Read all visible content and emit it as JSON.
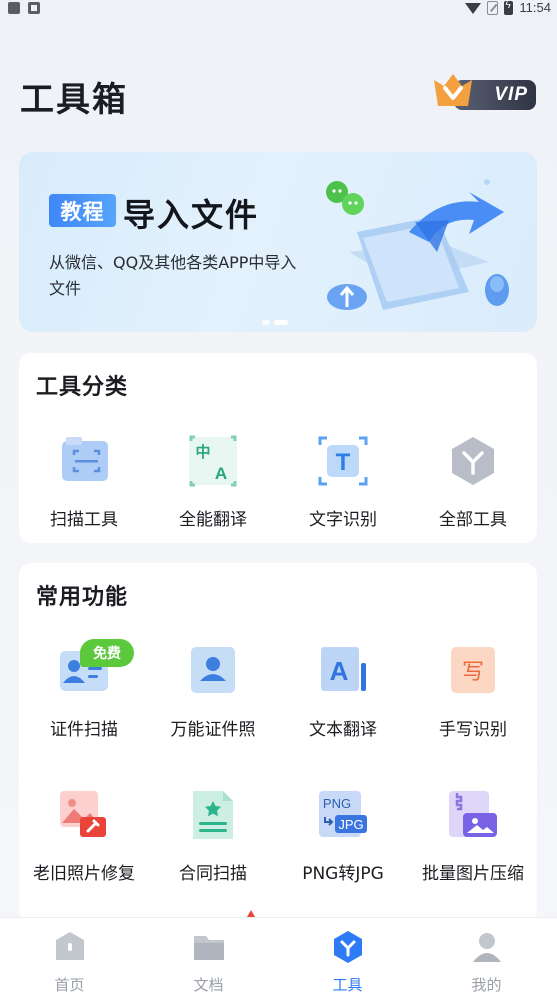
{
  "status_bar": {
    "time": "11:54"
  },
  "header": {
    "title": "工具箱",
    "vip_label": "VIP"
  },
  "banner": {
    "tag": "教程",
    "title": "导入文件",
    "subtitle": "从微信、QQ及其他各类APP中导入文件"
  },
  "tool_categories": {
    "title": "工具分类",
    "items": [
      {
        "label": "扫描工具",
        "icon": "scan-icon"
      },
      {
        "label": "全能翻译",
        "icon": "translate-icon"
      },
      {
        "label": "文字识别",
        "icon": "text-recognition-icon"
      },
      {
        "label": "全部工具",
        "icon": "all-tools-icon"
      }
    ]
  },
  "common_functions": {
    "title": "常用功能",
    "free_badge": "免费",
    "items": [
      {
        "label": "证件扫描",
        "icon": "id-card-scan-icon"
      },
      {
        "label": "万能证件照",
        "icon": "id-photo-icon"
      },
      {
        "label": "文本翻译",
        "icon": "text-translate-icon"
      },
      {
        "label": "手写识别",
        "icon": "handwriting-icon"
      },
      {
        "label": "老旧照片修复",
        "icon": "photo-repair-icon"
      },
      {
        "label": "合同扫描",
        "icon": "contract-scan-icon"
      },
      {
        "label": "PNG转JPG",
        "icon": "png-to-jpg-icon"
      },
      {
        "label": "批量图片压缩",
        "icon": "image-compress-icon"
      }
    ]
  },
  "bottom_nav": {
    "items": [
      {
        "label": "首页",
        "icon": "home-icon"
      },
      {
        "label": "文档",
        "icon": "folder-icon"
      },
      {
        "label": "工具",
        "icon": "tools-icon",
        "active": true
      },
      {
        "label": "我的",
        "icon": "profile-icon"
      }
    ],
    "active_color": "#2e7cf5",
    "inactive_color": "#9aa0a8"
  },
  "icon_glyphs": {
    "png_label": "PNG",
    "jpg_label": "JPG",
    "translate_zh": "中",
    "translate_a": "A",
    "ocr_t": "T",
    "text_translate_a": "A",
    "handwrite_char": "写"
  }
}
